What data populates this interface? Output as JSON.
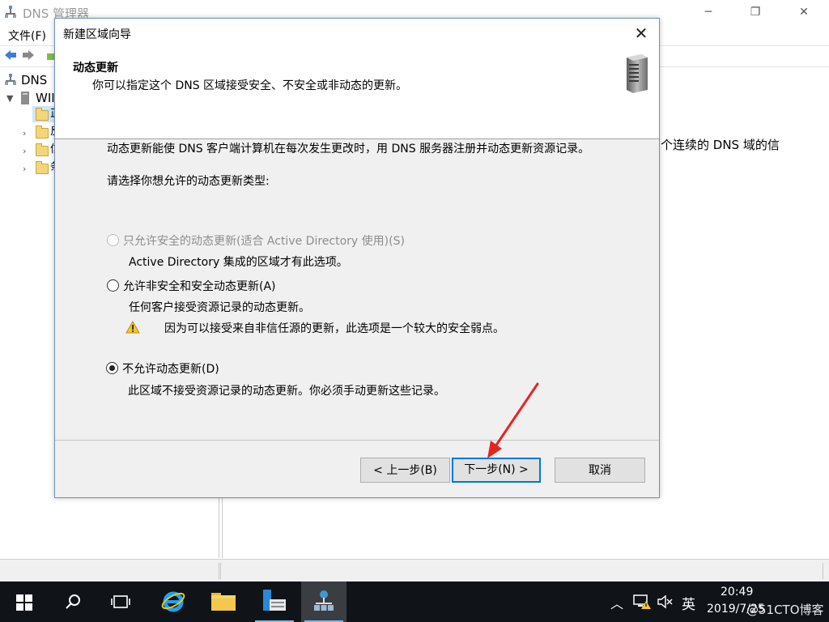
{
  "main_window": {
    "title": "DNS 管理器",
    "controls": {
      "minimize": "─",
      "maximize": "❐",
      "close": "✕"
    },
    "menu": [
      "文件(F)"
    ],
    "tree": {
      "root": "DNS",
      "server": "WII",
      "children": [
        "正",
        "反",
        "信",
        "条"
      ]
    },
    "right_pane_text": "个连续的 DNS 域的信"
  },
  "dialog": {
    "title": "新建区域向导",
    "close_glyph": "✕",
    "header_title": "动态更新",
    "header_subtitle": "你可以指定这个 DNS 区域接受安全、不安全或非动态的更新。",
    "intro": "动态更新能使 DNS 客户端计算机在每次发生更改时，用 DNS 服务器注册并动态更新资源记录。",
    "prompt": "请选择你想允许的动态更新类型:",
    "options": [
      {
        "label": "只允许安全的动态更新(适合 Active Directory 使用)(S)",
        "description": "Active Directory 集成的区域才有此选项。",
        "enabled": false,
        "checked": false
      },
      {
        "label": "允许非安全和安全动态更新(A)",
        "description": "任何客户接受资源记录的动态更新。",
        "warning": "因为可以接受来自非信任源的更新，此选项是一个较大的安全弱点。",
        "enabled": true,
        "checked": false
      },
      {
        "label": "不允许动态更新(D)",
        "description": "此区域不接受资源记录的动态更新。你必须手动更新这些记录。",
        "enabled": true,
        "checked": true
      }
    ],
    "buttons": {
      "back": "< 上一步(B)",
      "next": "下一步(N) >",
      "cancel": "取消"
    }
  },
  "taskbar": {
    "time": "20:49",
    "date": "2019/7/25",
    "ime": "英",
    "watermark": "@51CTO博客"
  },
  "colors": {
    "accent": "#0078d7",
    "annotation_arrow": "#e8231e",
    "taskbar": "#101318"
  }
}
